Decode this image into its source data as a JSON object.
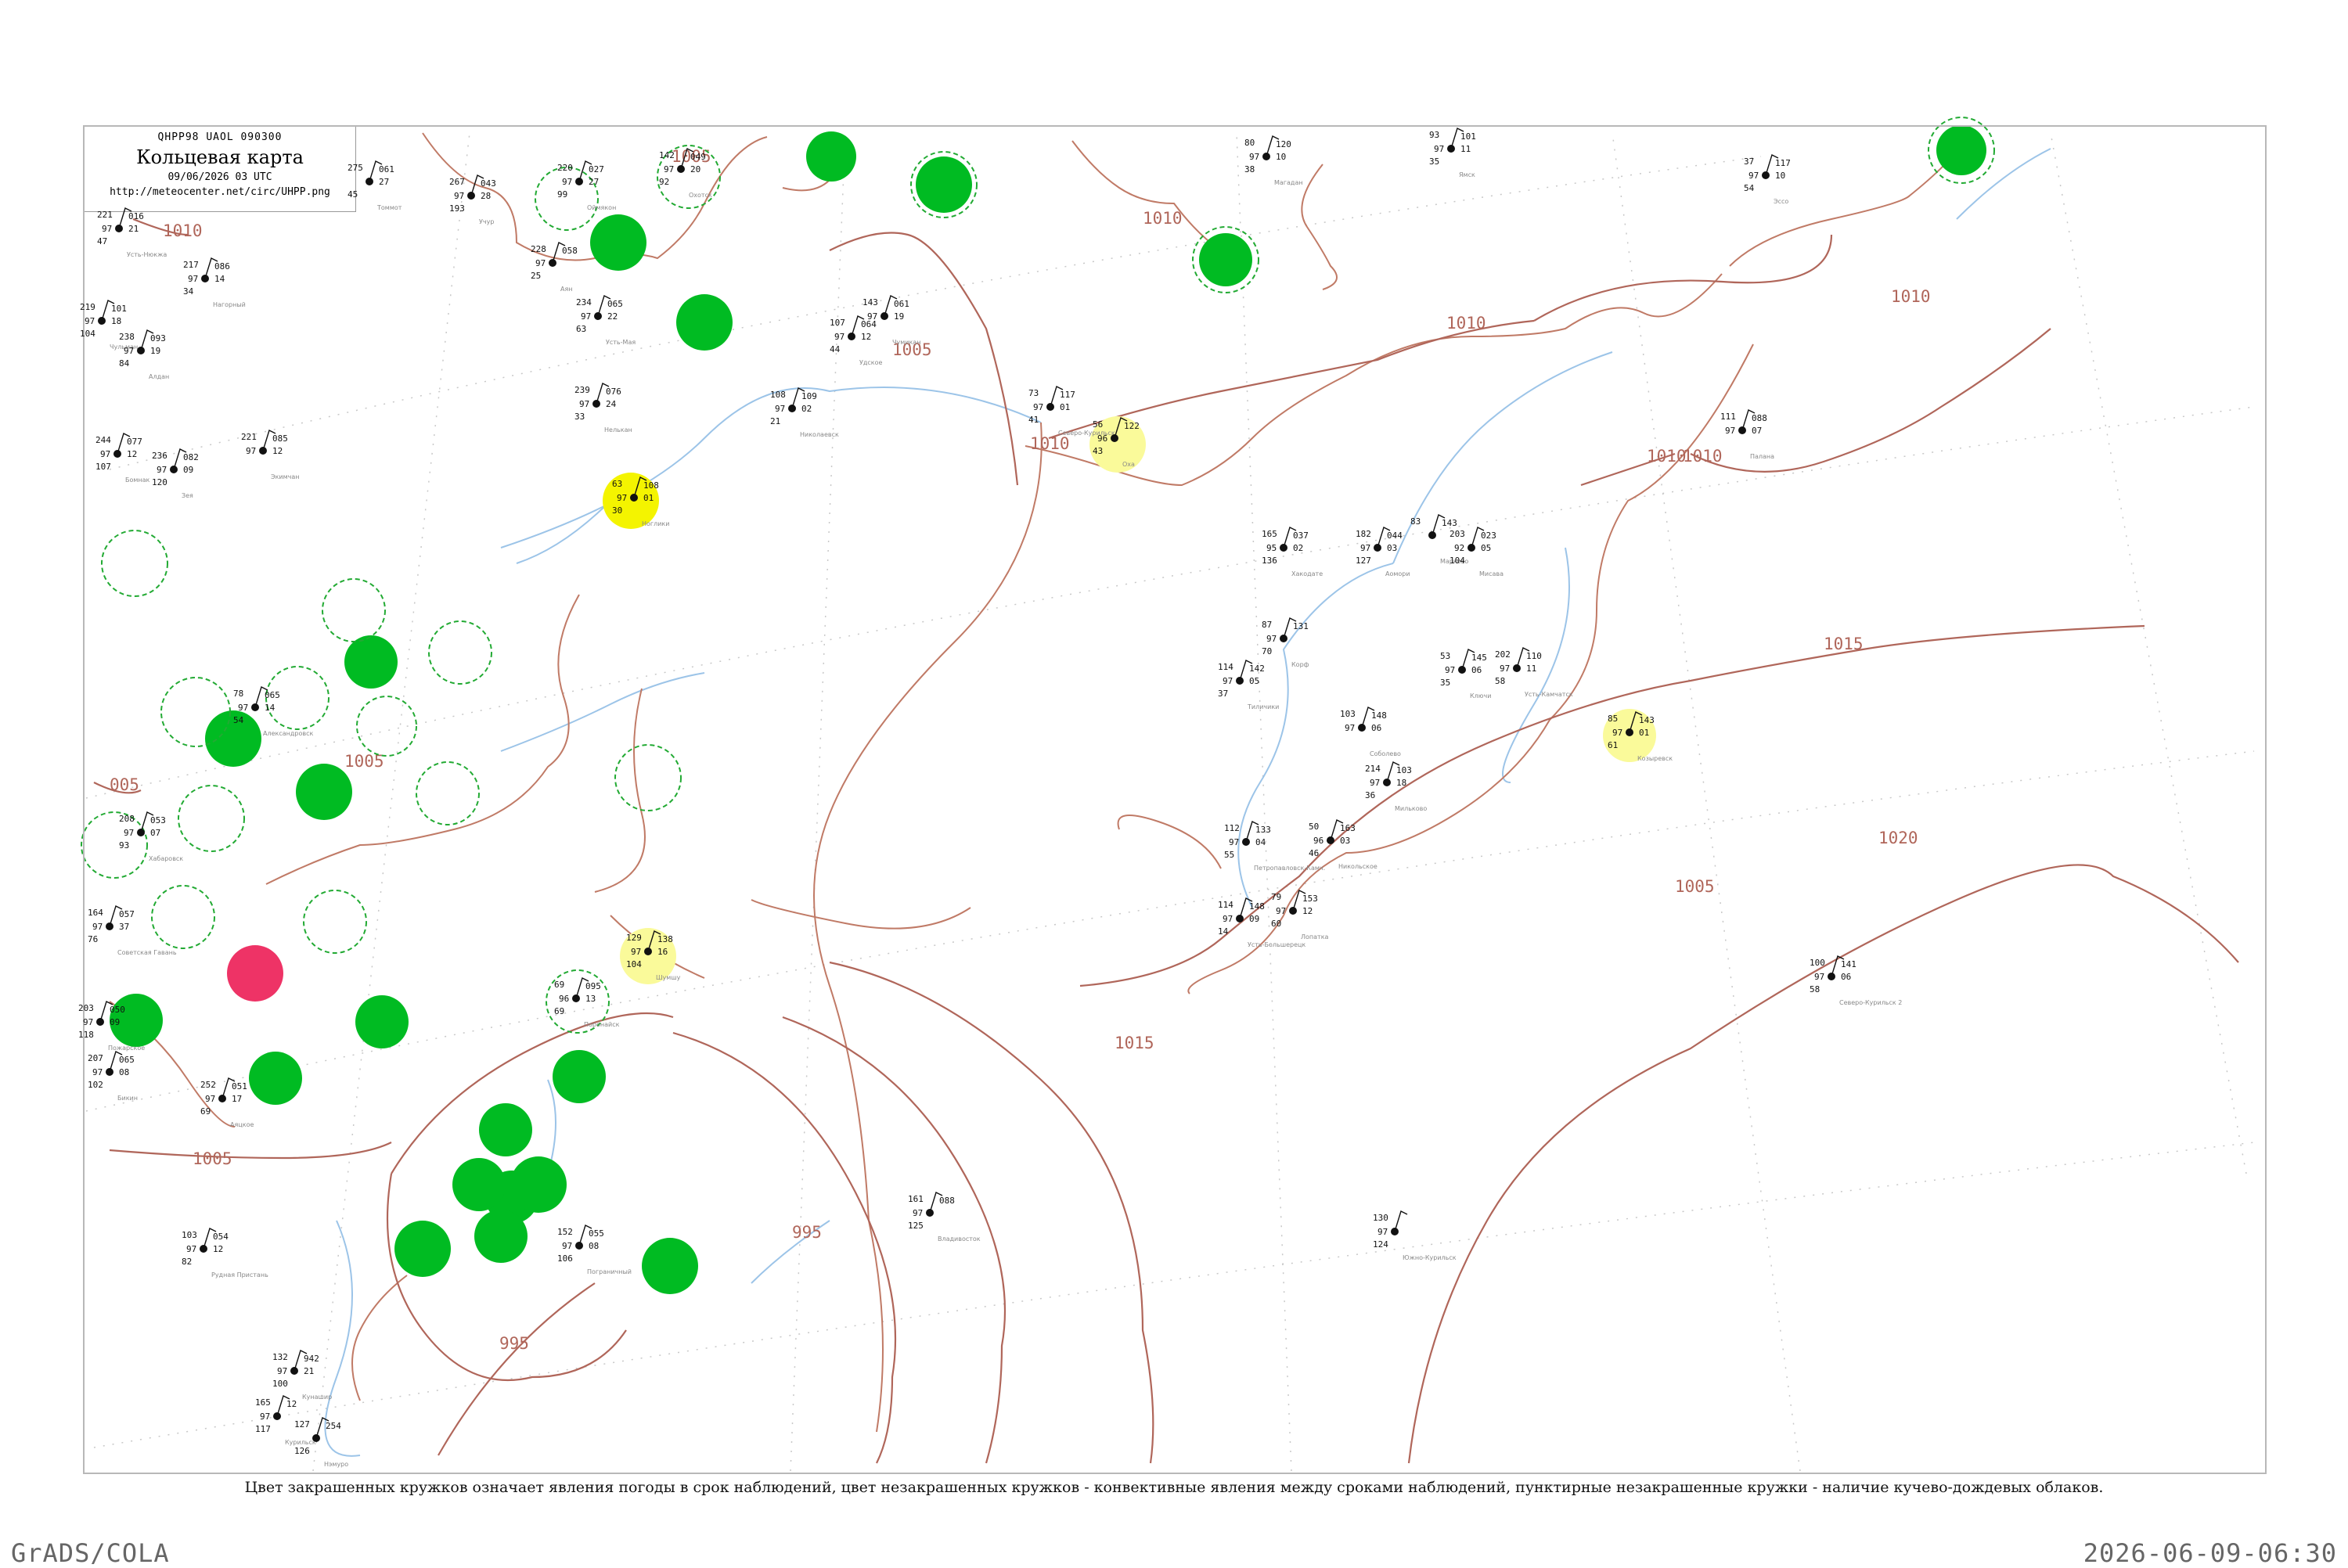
{
  "header": {
    "code": "QHPP98  UAOL  090300",
    "title": "Кольцевая карта",
    "datetime": "09/06/2026 03 UTC",
    "url": "http://meteocenter.net/circ/UHPP.png"
  },
  "isobars": [
    {
      "label": "1010"
    },
    {
      "label": "1005"
    },
    {
      "label": "1005"
    },
    {
      "label": "1010"
    },
    {
      "label": "1010"
    },
    {
      "label": "1010"
    },
    {
      "label": "1010"
    },
    {
      "label": "1010"
    },
    {
      "label": "1015"
    },
    {
      "label": "1020"
    },
    {
      "label": "1015"
    },
    {
      "label": "1005"
    },
    {
      "label": "1005"
    },
    {
      "label": "995"
    },
    {
      "label": "995"
    },
    {
      "label": "005"
    },
    {
      "label": "1005"
    },
    {
      "label": "1010"
    }
  ],
  "stations": [
    {
      "name": "Усть-Нюкжа",
      "top": "221",
      "right": "016",
      "pw": "97",
      "td": "47",
      "tend": "21"
    },
    {
      "name": "Нагорный",
      "top": "217",
      "right": "086",
      "pw": "97",
      "td": "34",
      "tend": "14"
    },
    {
      "name": "Чульман",
      "top": "219",
      "right": "101",
      "pw": "97",
      "td": "104",
      "tend": "18"
    },
    {
      "name": "Алдан",
      "top": "238",
      "right": "093",
      "pw": "97",
      "td": "84",
      "tend": "19"
    },
    {
      "name": "Томмот",
      "top": "275",
      "right": "061",
      "pw": "",
      "td": "45",
      "tend": "27"
    },
    {
      "name": "Учур",
      "top": "267",
      "right": "043",
      "pw": "97",
      "td": "193",
      "tend": "28"
    },
    {
      "name": "Оймякон",
      "top": "220",
      "right": "027",
      "pw": "97",
      "td": "99",
      "tend": "27"
    },
    {
      "name": "Охотск",
      "top": "142",
      "right": "049",
      "pw": "97",
      "td": "92",
      "tend": "20"
    },
    {
      "name": "Аян",
      "top": "228",
      "right": "058",
      "pw": "97",
      "td": "25",
      "tend": ""
    },
    {
      "name": "Усть-Мая",
      "top": "234",
      "right": "065",
      "pw": "97",
      "td": "63",
      "tend": "22"
    },
    {
      "name": "Нелькан",
      "top": "239",
      "right": "076",
      "pw": "97",
      "td": "33",
      "tend": "24"
    },
    {
      "name": "Бомнак",
      "top": "244",
      "right": "077",
      "pw": "97",
      "td": "107",
      "tend": "12"
    },
    {
      "name": "Зея",
      "top": "236",
      "right": "082",
      "pw": "97",
      "td": "120",
      "tend": "09"
    },
    {
      "name": "Экимчан",
      "top": "221",
      "right": "085",
      "pw": "97",
      "td": "",
      "tend": "12"
    },
    {
      "name": "Чумикан",
      "top": "143",
      "right": "061",
      "pw": "97",
      "td": "",
      "tend": "19"
    },
    {
      "name": "Удское",
      "top": "107",
      "right": "064",
      "pw": "97",
      "td": "44",
      "tend": "12"
    },
    {
      "name": "Николаевск",
      "top": "108",
      "right": "109",
      "pw": "97",
      "td": "21",
      "tend": "02"
    },
    {
      "name": "Магадан",
      "top": "80",
      "right": "120",
      "pw": "97",
      "td": "38",
      "tend": "10"
    },
    {
      "name": "Ямск",
      "top": "93",
      "right": "101",
      "pw": "97",
      "td": "35",
      "tend": "11"
    },
    {
      "name": "Северо-Курильск",
      "top": "73",
      "right": "117",
      "pw": "97",
      "td": "41",
      "tend": "01"
    },
    {
      "name": "Оха",
      "top": "56",
      "right": "122",
      "pw": "96",
      "td": "43",
      "tend": ""
    },
    {
      "name": "Ноглики",
      "top": "63",
      "right": "108",
      "pw": "97",
      "td": "30",
      "tend": "01"
    },
    {
      "name": "Палана",
      "top": "111",
      "right": "088",
      "pw": "97",
      "td": "",
      "tend": "07"
    },
    {
      "name": "Эссо",
      "top": "37",
      "right": "117",
      "pw": "97",
      "td": "54",
      "tend": "10"
    },
    {
      "name": "Марково",
      "top": "83",
      "right": "143",
      "pw": "",
      "td": "",
      "tend": ""
    },
    {
      "name": "Ключи",
      "top": "53",
      "right": "145",
      "pw": "97",
      "td": "35",
      "tend": "06"
    },
    {
      "name": "Усть-Камчатск",
      "top": "202",
      "right": "110",
      "pw": "97",
      "td": "58",
      "tend": "11"
    },
    {
      "name": "Корф",
      "top": "87",
      "right": "131",
      "pw": "97",
      "td": "70",
      "tend": ""
    },
    {
      "name": "Тиличики",
      "top": "114",
      "right": "142",
      "pw": "97",
      "td": "37",
      "tend": "05"
    },
    {
      "name": "Соболево",
      "top": "103",
      "right": "148",
      "pw": "97",
      "td": "",
      "tend": "06"
    },
    {
      "name": "Мильково",
      "top": "214",
      "right": "103",
      "pw": "97",
      "td": "36",
      "tend": "18"
    },
    {
      "name": "Козыревск",
      "top": "85",
      "right": "143",
      "pw": "97",
      "td": "61",
      "tend": "01"
    },
    {
      "name": "Никольское",
      "top": "50",
      "right": "163",
      "pw": "96",
      "td": "46",
      "tend": "03"
    },
    {
      "name": "Петропавловск-Камч.",
      "top": "112",
      "right": "133",
      "pw": "97",
      "td": "55",
      "tend": "04"
    },
    {
      "name": "Усть-Большерецк",
      "top": "114",
      "right": "148",
      "pw": "97",
      "td": "14",
      "tend": "09"
    },
    {
      "name": "Лопатка",
      "top": "79",
      "right": "153",
      "pw": "97",
      "td": "60",
      "tend": "12"
    },
    {
      "name": "Северо-Курильск 2",
      "top": "100",
      "right": "141",
      "pw": "97",
      "td": "58",
      "tend": "06"
    },
    {
      "name": "Шумшу",
      "top": "129",
      "right": "138",
      "pw": "97",
      "td": "104",
      "tend": "16"
    },
    {
      "name": "Поронайск",
      "top": "69",
      "right": "095",
      "pw": "96",
      "td": "69",
      "tend": "13"
    },
    {
      "name": "Александровск",
      "top": "78",
      "right": "065",
      "pw": "97",
      "td": "54",
      "tend": "14"
    },
    {
      "name": "Хабаровск",
      "top": "208",
      "right": "053",
      "pw": "97",
      "td": "93",
      "tend": "07"
    },
    {
      "name": "Советская Гавань",
      "top": "164",
      "right": "057",
      "pw": "97",
      "td": "76",
      "tend": "37"
    },
    {
      "name": "Аяцкое",
      "top": "252",
      "right": "051",
      "pw": "97",
      "td": "69",
      "tend": "17"
    },
    {
      "name": "Бикин",
      "top": "207",
      "right": "065",
      "pw": "97",
      "td": "102",
      "tend": "08"
    },
    {
      "name": "Пожарское",
      "top": "203",
      "right": "050",
      "pw": "97",
      "td": "118",
      "tend": "09"
    },
    {
      "name": "Рудная Пристань",
      "top": "103",
      "right": "054",
      "pw": "97",
      "td": "82",
      "tend": "12"
    },
    {
      "name": "Пограничный",
      "top": "152",
      "right": "055",
      "pw": "97",
      "td": "106",
      "tend": "08"
    },
    {
      "name": "Владивосток",
      "top": "161",
      "right": "088",
      "pw": "97",
      "td": "125",
      "tend": ""
    },
    {
      "name": "Южно-Курильск",
      "top": "130",
      "right": "",
      "pw": "97",
      "td": "124",
      "tend": ""
    },
    {
      "name": "Кунашир",
      "top": "132",
      "right": "942",
      "pw": "97",
      "td": "100",
      "tend": "21"
    },
    {
      "name": "Курильск",
      "top": "165",
      "right": "12",
      "pw": "97",
      "td": "117",
      "tend": ""
    },
    {
      "name": "Нэмуро",
      "top": "127",
      "right": "254",
      "pw": "",
      "td": "126",
      "tend": ""
    },
    {
      "name": "Хакодате",
      "top": "165",
      "right": "037",
      "pw": "95",
      "td": "136",
      "tend": "02"
    },
    {
      "name": "Аомори",
      "top": "182",
      "right": "044",
      "pw": "97",
      "td": "127",
      "tend": "03"
    },
    {
      "name": "Мисава",
      "top": "203",
      "right": "023",
      "pw": "92",
      "td": "104",
      "tend": "05"
    }
  ],
  "circle_legend": {
    "green": "#00bb22",
    "yellow": "#f4f400",
    "light_yellow": "#fafa9a",
    "red": "#ee3366",
    "dashed_green": "#22aa33"
  },
  "colors": {
    "isobar": "#b0665a",
    "coast": "#c07a66",
    "river": "#9cc4e8",
    "frame": "#b8b8b8"
  },
  "caption": "Цвет закрашенных кружков означает явления погоды в срок наблюдений, цвет незакрашенных кружков - конвективные явления между сроками наблюдений, пунктирные незакрашенные кружки - наличие кучево-дождевых облаков.",
  "footer_left": "GrADS/COLA",
  "footer_right": "2026-06-09-06:30"
}
